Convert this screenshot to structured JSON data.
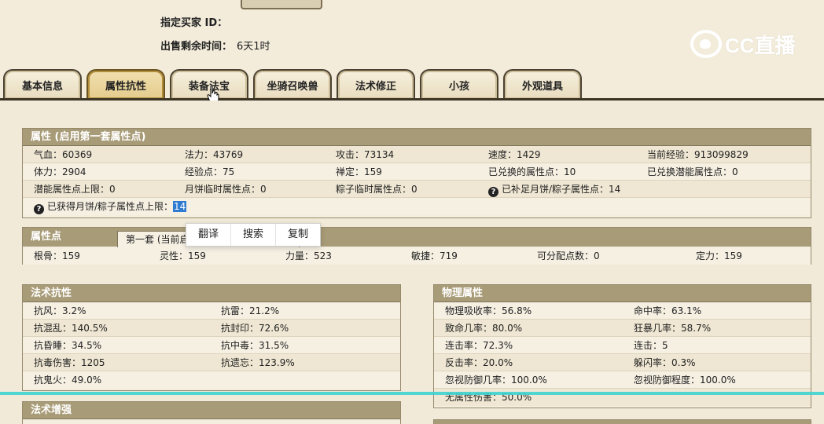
{
  "seller": {
    "buyer_id_label": "指定买家 ID：",
    "time_left_label": "出售剩余时间：",
    "time_left_value": "6天1时"
  },
  "logo": {
    "text": "CC直播",
    "icon": "cc-live-logo-icon"
  },
  "tabs": [
    "基本信息",
    "属性抗性",
    "装备法宝",
    "坐骑召唤兽",
    "法术修正",
    "小孩",
    "外观道具"
  ],
  "active_tab": "属性抗性",
  "attributes": {
    "title": "属性 (启用第一套属性点)",
    "rows": [
      [
        "气血：60369",
        "法力：43769",
        "攻击：73134",
        "速度：1429",
        "当前经验：913099829"
      ],
      [
        "体力：2904",
        "经验点：75",
        "禅定：159",
        "已兑换的属性点：10",
        "已兑换潜能属性点：0"
      ],
      [
        "潜能属性点上限：0",
        "月饼临时属性点：0",
        "粽子临时属性点：0",
        "已补足月饼/粽子属性点：14",
        ""
      ]
    ],
    "obtained_label": "已获得月饼/粽子属性点上限：",
    "obtained_value": "14"
  },
  "points": {
    "title": "属性点",
    "subtab": "第一套 (当前启",
    "values": [
      "根骨：159",
      "灵性：159",
      "力量：523",
      "敏捷：719",
      "可分配点数：0",
      "定力：159"
    ]
  },
  "context_menu": [
    "翻译",
    "搜索",
    "复制"
  ],
  "resist": {
    "title": "法术抗性",
    "rows": [
      [
        "抗风：3.2%",
        "抗雷：21.2%"
      ],
      [
        "抗混乱：140.5%",
        "抗封印：72.6%"
      ],
      [
        "抗昏睡：34.5%",
        "抗中毒：31.5%"
      ],
      [
        "抗毒伤害：1205",
        "抗遗忘：123.9%"
      ],
      [
        "抗鬼火：49.0%",
        ""
      ]
    ]
  },
  "physical": {
    "title": "物理属性",
    "rows": [
      [
        "物理吸收率：56.8%",
        "命中率：63.1%"
      ],
      [
        "致命几率：80.0%",
        "狂暴几率：58.7%"
      ],
      [
        "连击率：72.3%",
        "连击：5"
      ],
      [
        "反击率：20.0%",
        "躲闪率：0.3%"
      ],
      [
        "忽视防御几率：100.0%",
        "忽视防御程度：100.0%"
      ],
      [
        "无属性伤害：50.0%",
        ""
      ]
    ]
  },
  "enhance": {
    "title": "法术增强"
  },
  "colors": {
    "panel_head": "#a89b77",
    "highlight": "#2f7bd1",
    "overlay_line": "#3ed3d0"
  }
}
